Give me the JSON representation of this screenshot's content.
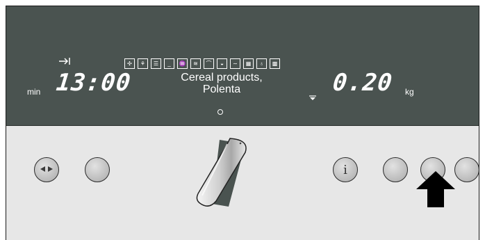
{
  "display": {
    "timer_icon": "timer-start-icon",
    "time_unit": "min",
    "time_value": "13:00",
    "program_line1": "Cereal products,",
    "program_line2": "Polenta",
    "weight_value": "0.20",
    "weight_unit": "kg",
    "mode_icons": [
      "fan-icon",
      "fan-grill-icon",
      "top-bottom-heat-icon",
      "bottom-heat-icon",
      "grill-fan-icon",
      "full-grill-icon",
      "half-grill-icon",
      "pizza-icon",
      "low-heat-icon",
      "defrost-icon",
      "lamp-icon",
      "grid-icon"
    ]
  },
  "controls": {
    "left_button_1_icon": "arrows-left-right-icon",
    "info_button_label": "i"
  },
  "colors": {
    "display_bg": "#4a5350",
    "panel_bg": "#e7e7e7",
    "button_gray": "#a9a9a9"
  }
}
